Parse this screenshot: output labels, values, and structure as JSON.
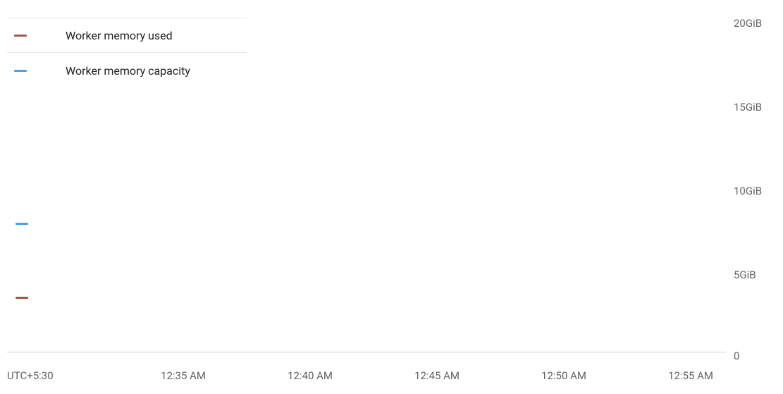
{
  "chart_data": {
    "type": "line",
    "title": "",
    "xlabel": "",
    "ylabel": "",
    "ylim": [
      0,
      20
    ],
    "y_unit": "GiB",
    "y_ticks": [
      0,
      5,
      10,
      15,
      20
    ],
    "y_tick_labels": [
      "0",
      "5GiB",
      "10GiB",
      "15GiB",
      "20GiB"
    ],
    "x_ticks": [
      "12:35 AM",
      "12:40 AM",
      "12:45 AM",
      "12:50 AM",
      "12:55 AM"
    ],
    "timezone_label": "UTC+5:30",
    "series": [
      {
        "name": "Worker memory used",
        "color": "#a05a4a",
        "values": [
          3.2
        ]
      },
      {
        "name": "Worker memory capacity",
        "color": "#4aa3df",
        "values": [
          7.5
        ]
      }
    ]
  },
  "legend": {
    "items": [
      {
        "label": "Worker memory used",
        "color": "#a05a4a"
      },
      {
        "label": "Worker memory capacity",
        "color": "#4aa3df"
      }
    ]
  },
  "y_axis": {
    "t0": "20GiB",
    "t1": "15GiB",
    "t2": "10GiB",
    "t3": "5GiB",
    "t4": "0"
  },
  "x_axis": {
    "tz": "UTC+5:30",
    "t0": "12:35 AM",
    "t1": "12:40 AM",
    "t2": "12:45 AM",
    "t3": "12:50 AM",
    "t4": "12:55 AM"
  },
  "colors": {
    "used": "#a05a4a",
    "capacity": "#4aa3df"
  }
}
